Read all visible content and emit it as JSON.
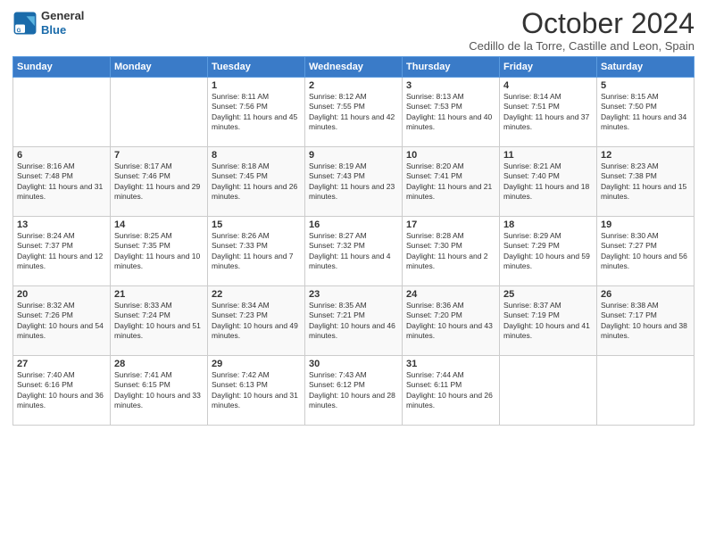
{
  "header": {
    "logo_line1": "General",
    "logo_line2": "Blue",
    "month": "October 2024",
    "location": "Cedillo de la Torre, Castille and Leon, Spain"
  },
  "days_of_week": [
    "Sunday",
    "Monday",
    "Tuesday",
    "Wednesday",
    "Thursday",
    "Friday",
    "Saturday"
  ],
  "weeks": [
    [
      {
        "day": "",
        "text": ""
      },
      {
        "day": "",
        "text": ""
      },
      {
        "day": "1",
        "text": "Sunrise: 8:11 AM\nSunset: 7:56 PM\nDaylight: 11 hours and 45 minutes."
      },
      {
        "day": "2",
        "text": "Sunrise: 8:12 AM\nSunset: 7:55 PM\nDaylight: 11 hours and 42 minutes."
      },
      {
        "day": "3",
        "text": "Sunrise: 8:13 AM\nSunset: 7:53 PM\nDaylight: 11 hours and 40 minutes."
      },
      {
        "day": "4",
        "text": "Sunrise: 8:14 AM\nSunset: 7:51 PM\nDaylight: 11 hours and 37 minutes."
      },
      {
        "day": "5",
        "text": "Sunrise: 8:15 AM\nSunset: 7:50 PM\nDaylight: 11 hours and 34 minutes."
      }
    ],
    [
      {
        "day": "6",
        "text": "Sunrise: 8:16 AM\nSunset: 7:48 PM\nDaylight: 11 hours and 31 minutes."
      },
      {
        "day": "7",
        "text": "Sunrise: 8:17 AM\nSunset: 7:46 PM\nDaylight: 11 hours and 29 minutes."
      },
      {
        "day": "8",
        "text": "Sunrise: 8:18 AM\nSunset: 7:45 PM\nDaylight: 11 hours and 26 minutes."
      },
      {
        "day": "9",
        "text": "Sunrise: 8:19 AM\nSunset: 7:43 PM\nDaylight: 11 hours and 23 minutes."
      },
      {
        "day": "10",
        "text": "Sunrise: 8:20 AM\nSunset: 7:41 PM\nDaylight: 11 hours and 21 minutes."
      },
      {
        "day": "11",
        "text": "Sunrise: 8:21 AM\nSunset: 7:40 PM\nDaylight: 11 hours and 18 minutes."
      },
      {
        "day": "12",
        "text": "Sunrise: 8:23 AM\nSunset: 7:38 PM\nDaylight: 11 hours and 15 minutes."
      }
    ],
    [
      {
        "day": "13",
        "text": "Sunrise: 8:24 AM\nSunset: 7:37 PM\nDaylight: 11 hours and 12 minutes."
      },
      {
        "day": "14",
        "text": "Sunrise: 8:25 AM\nSunset: 7:35 PM\nDaylight: 11 hours and 10 minutes."
      },
      {
        "day": "15",
        "text": "Sunrise: 8:26 AM\nSunset: 7:33 PM\nDaylight: 11 hours and 7 minutes."
      },
      {
        "day": "16",
        "text": "Sunrise: 8:27 AM\nSunset: 7:32 PM\nDaylight: 11 hours and 4 minutes."
      },
      {
        "day": "17",
        "text": "Sunrise: 8:28 AM\nSunset: 7:30 PM\nDaylight: 11 hours and 2 minutes."
      },
      {
        "day": "18",
        "text": "Sunrise: 8:29 AM\nSunset: 7:29 PM\nDaylight: 10 hours and 59 minutes."
      },
      {
        "day": "19",
        "text": "Sunrise: 8:30 AM\nSunset: 7:27 PM\nDaylight: 10 hours and 56 minutes."
      }
    ],
    [
      {
        "day": "20",
        "text": "Sunrise: 8:32 AM\nSunset: 7:26 PM\nDaylight: 10 hours and 54 minutes."
      },
      {
        "day": "21",
        "text": "Sunrise: 8:33 AM\nSunset: 7:24 PM\nDaylight: 10 hours and 51 minutes."
      },
      {
        "day": "22",
        "text": "Sunrise: 8:34 AM\nSunset: 7:23 PM\nDaylight: 10 hours and 49 minutes."
      },
      {
        "day": "23",
        "text": "Sunrise: 8:35 AM\nSunset: 7:21 PM\nDaylight: 10 hours and 46 minutes."
      },
      {
        "day": "24",
        "text": "Sunrise: 8:36 AM\nSunset: 7:20 PM\nDaylight: 10 hours and 43 minutes."
      },
      {
        "day": "25",
        "text": "Sunrise: 8:37 AM\nSunset: 7:19 PM\nDaylight: 10 hours and 41 minutes."
      },
      {
        "day": "26",
        "text": "Sunrise: 8:38 AM\nSunset: 7:17 PM\nDaylight: 10 hours and 38 minutes."
      }
    ],
    [
      {
        "day": "27",
        "text": "Sunrise: 7:40 AM\nSunset: 6:16 PM\nDaylight: 10 hours and 36 minutes."
      },
      {
        "day": "28",
        "text": "Sunrise: 7:41 AM\nSunset: 6:15 PM\nDaylight: 10 hours and 33 minutes."
      },
      {
        "day": "29",
        "text": "Sunrise: 7:42 AM\nSunset: 6:13 PM\nDaylight: 10 hours and 31 minutes."
      },
      {
        "day": "30",
        "text": "Sunrise: 7:43 AM\nSunset: 6:12 PM\nDaylight: 10 hours and 28 minutes."
      },
      {
        "day": "31",
        "text": "Sunrise: 7:44 AM\nSunset: 6:11 PM\nDaylight: 10 hours and 26 minutes."
      },
      {
        "day": "",
        "text": ""
      },
      {
        "day": "",
        "text": ""
      }
    ]
  ]
}
